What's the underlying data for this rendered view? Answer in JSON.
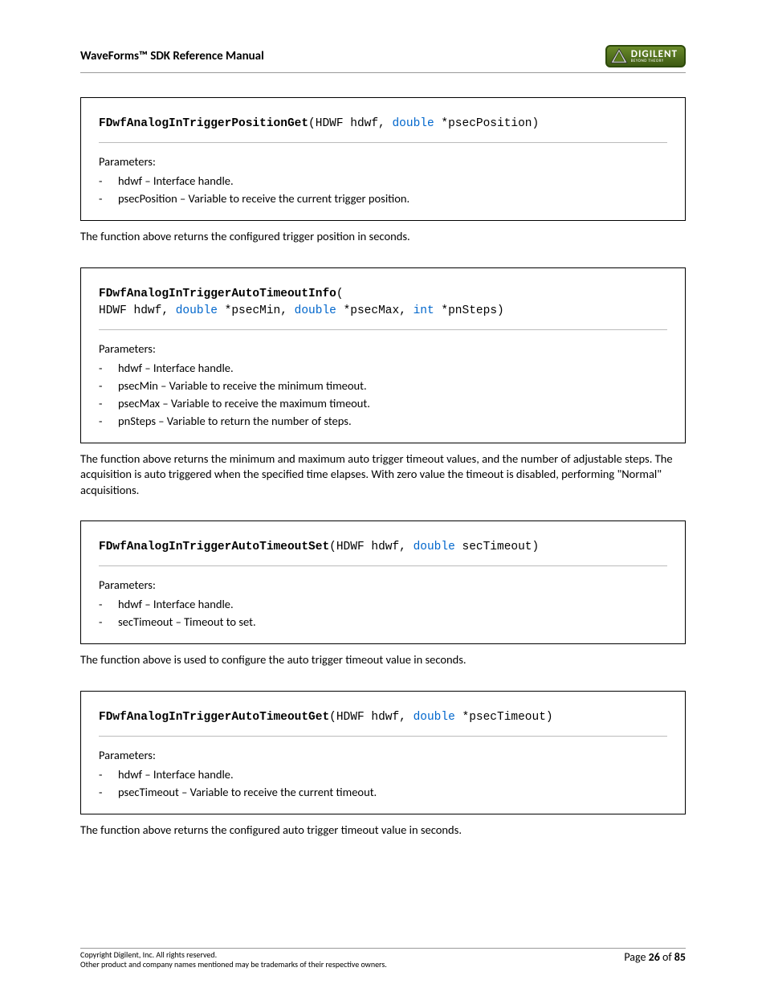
{
  "header": {
    "title": "WaveForms™ SDK Reference Manual"
  },
  "logo": {
    "name": "DIGILENT",
    "tag": "BEYOND THEORY"
  },
  "functions": [
    {
      "name": "FDwfAnalogInTriggerPositionGet",
      "sig_html": "(HDWF hdwf, <span class='kw'>double</span> *psecPosition)",
      "params_label": "Parameters:",
      "params": [
        "hdwf – Interface handle.",
        "psecPosition – Variable to receive the current trigger position."
      ],
      "desc": "The function above returns the configured trigger position in seconds."
    },
    {
      "name": "FDwfAnalogInTriggerAutoTimeoutInfo",
      "sig_html": "(<br>HDWF hdwf, <span class='kw'>double</span> *psecMin, <span class='kw'>double</span> *psecMax, <span class='kw'>int</span> *pnSteps)",
      "params_label": "Parameters:",
      "params": [
        "hdwf – Interface handle.",
        "psecMin – Variable to receive the minimum timeout.",
        "psecMax – Variable to receive the maximum timeout.",
        "pnSteps – Variable to return the number of steps."
      ],
      "desc": "The function above returns the minimum and maximum auto trigger timeout values, and the number of adjustable steps. The acquisition is auto triggered when the specified time elapses. With zero value the timeout is disabled, performing \"Normal\" acquisitions."
    },
    {
      "name": "FDwfAnalogInTriggerAutoTimeoutSet",
      "sig_html": "(HDWF hdwf, <span class='kw'>double</span> secTimeout)",
      "params_label": "Parameters:",
      "params": [
        "hdwf – Interface handle.",
        "secTimeout – Timeout to set."
      ],
      "desc": "The function above is used to configure the auto trigger timeout value in seconds."
    },
    {
      "name": "FDwfAnalogInTriggerAutoTimeoutGet",
      "sig_html": "(HDWF hdwf, <span class='kw'>double</span> *psecTimeout)",
      "params_label": "Parameters:",
      "params": [
        "hdwf – Interface handle.",
        "psecTimeout – Variable to receive the current timeout."
      ],
      "desc": "The function above returns the configured auto trigger timeout value in seconds."
    }
  ],
  "footer": {
    "copyright": "Copyright Digilent, Inc. All rights reserved.",
    "trademark": "Other product and company names mentioned may be trademarks of their respective owners.",
    "page_label": "Page",
    "page_num": "26",
    "of": "of",
    "page_total": "85"
  }
}
